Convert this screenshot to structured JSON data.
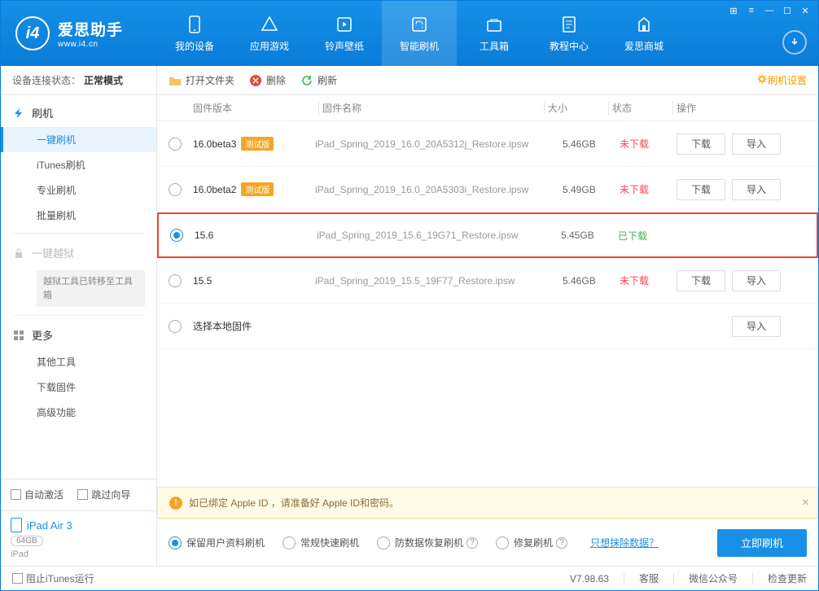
{
  "app": {
    "name": "爱思助手",
    "url": "www.i4.cn"
  },
  "nav": [
    {
      "label": "我的设备"
    },
    {
      "label": "应用游戏"
    },
    {
      "label": "铃声壁纸"
    },
    {
      "label": "智能刷机",
      "active": true
    },
    {
      "label": "工具箱"
    },
    {
      "label": "教程中心"
    },
    {
      "label": "爱思商城"
    }
  ],
  "sidebar": {
    "status_label": "设备连接状态：",
    "status_value": "正常模式",
    "groups": {
      "flash": "刷机",
      "jailbreak": "一键越狱",
      "jailbreak_note": "越狱工具已转移至工具箱",
      "more": "更多"
    },
    "items": {
      "one_click": "一键刷机",
      "itunes": "iTunes刷机",
      "pro": "专业刷机",
      "batch": "批量刷机",
      "other_tools": "其他工具",
      "download_fw": "下载固件",
      "advanced": "高级功能"
    },
    "auto_activate": "自动激活",
    "skip_guide": "跳过向导",
    "device": {
      "name": "iPad Air 3",
      "storage": "64GB",
      "type": "iPad"
    }
  },
  "toolbar": {
    "open_folder": "打开文件夹",
    "delete": "删除",
    "refresh": "刷新",
    "settings": "刷机设置"
  },
  "table": {
    "headers": {
      "version": "固件版本",
      "name": "固件名称",
      "size": "大小",
      "status": "状态",
      "ops": "操作"
    },
    "download": "下载",
    "import": "导入",
    "local": "选择本地固件",
    "rows": [
      {
        "ver": "16.0beta3",
        "beta": "测试版",
        "name": "iPad_Spring_2019_16.0_20A5312j_Restore.ipsw",
        "size": "5.46GB",
        "status": "未下载",
        "downloaded": false,
        "selected": false
      },
      {
        "ver": "16.0beta2",
        "beta": "测试版",
        "name": "iPad_Spring_2019_16.0_20A5303i_Restore.ipsw",
        "size": "5.49GB",
        "status": "未下载",
        "downloaded": false,
        "selected": false
      },
      {
        "ver": "15.6",
        "beta": "",
        "name": "iPad_Spring_2019_15.6_19G71_Restore.ipsw",
        "size": "5.45GB",
        "status": "已下载",
        "downloaded": true,
        "selected": true
      },
      {
        "ver": "15.5",
        "beta": "",
        "name": "iPad_Spring_2019_15.5_19F77_Restore.ipsw",
        "size": "5.46GB",
        "status": "未下载",
        "downloaded": false,
        "selected": false
      }
    ]
  },
  "warn": "如已绑定 Apple ID ，请准备好 Apple ID和密码。",
  "options": {
    "keep_data": "保留用户资料刷机",
    "normal": "常规快速刷机",
    "anti_recovery": "防数据恢复刷机",
    "repair": "修复刷机",
    "erase_link": "只想抹除数据？"
  },
  "flash_btn": "立即刷机",
  "footer": {
    "block_itunes": "阻止iTunes运行",
    "version": "V7.98.63",
    "service": "客服",
    "wechat": "微信公众号",
    "update": "检查更新"
  }
}
